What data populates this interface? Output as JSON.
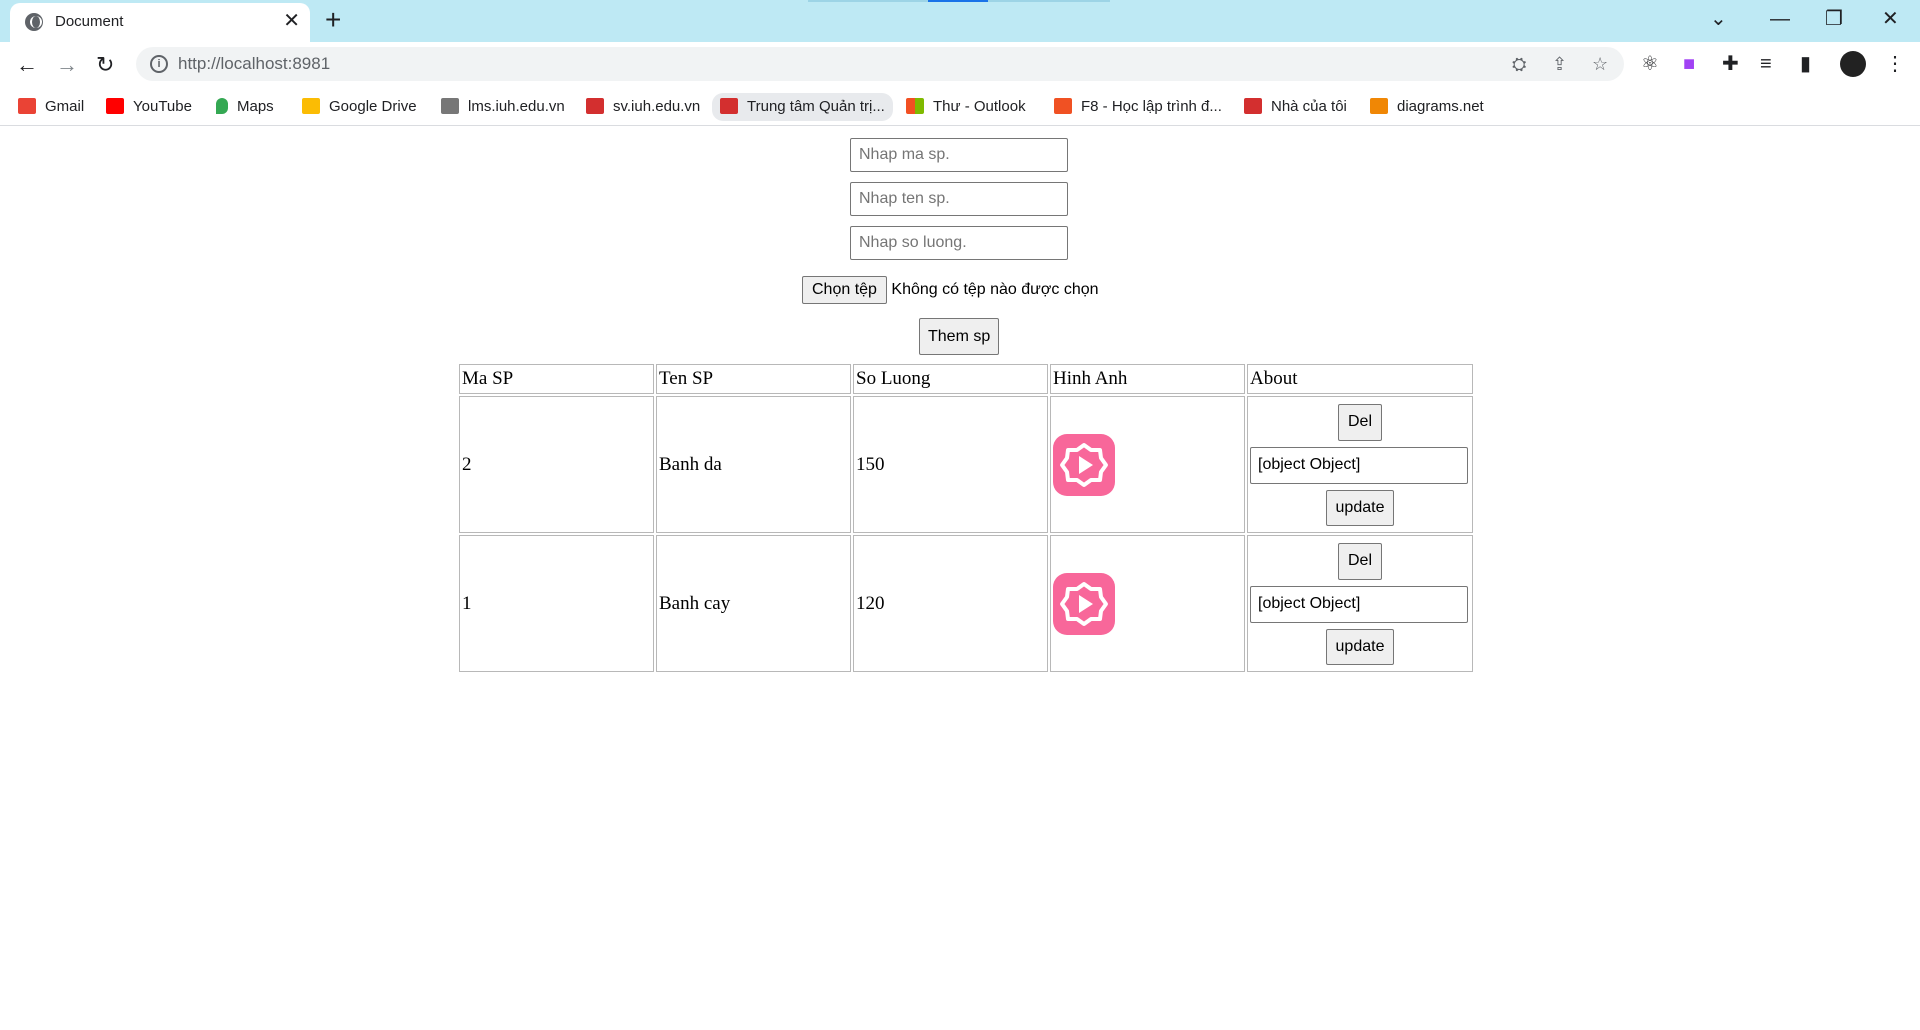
{
  "browser": {
    "tab_title": "Document",
    "url": "http://localhost:8981",
    "bookmarks": [
      {
        "label": "Gmail",
        "icon": "gmail-icon",
        "color": "#ea4335"
      },
      {
        "label": "YouTube",
        "icon": "youtube-icon",
        "color": "#ff0000"
      },
      {
        "label": "Maps",
        "icon": "maps-icon",
        "color": "#34a853"
      },
      {
        "label": "Google Drive",
        "icon": "google-drive-icon",
        "color": "#fbbc04"
      },
      {
        "label": "lms.iuh.edu.vn",
        "icon": "lms-icon",
        "color": "#777777"
      },
      {
        "label": "sv.iuh.edu.vn",
        "icon": "iuh-icon",
        "color": "#d32f2f"
      },
      {
        "label": "Trung tâm Quản trị...",
        "icon": "iuh-icon",
        "color": "#d32f2f"
      },
      {
        "label": "Thư  - Outlook",
        "icon": "microsoft-icon",
        "color": "#0078d4"
      },
      {
        "label": "F8 - Học lập trình đ...",
        "icon": "f8-icon",
        "color": "#f05123"
      },
      {
        "label": "Nhà của tôi",
        "icon": "iuh-icon",
        "color": "#d32f2f"
      },
      {
        "label": "diagrams.net",
        "icon": "diagrams-icon",
        "color": "#f08705"
      }
    ]
  },
  "form": {
    "ma_placeholder": "Nhap ma sp.",
    "ten_placeholder": "Nhap ten sp.",
    "soluong_placeholder": "Nhap so luong.",
    "file_button": "Chọn tệp",
    "file_status": "Không có tệp nào được chọn",
    "submit_label": "Them sp"
  },
  "table": {
    "headers": [
      "Ma SP",
      "Ten SP",
      "So Luong",
      "Hinh Anh",
      "About"
    ],
    "rows": [
      {
        "ma": "2",
        "ten": "Banh da",
        "soluong": "150",
        "about_value": "[object Object]"
      },
      {
        "ma": "1",
        "ten": "Banh cay",
        "soluong": "120",
        "about_value": "[object Object]"
      }
    ],
    "del_label": "Del",
    "update_label": "update"
  },
  "colors": {
    "titlebar": "#bee9f4",
    "thumb": "#f8679a"
  }
}
